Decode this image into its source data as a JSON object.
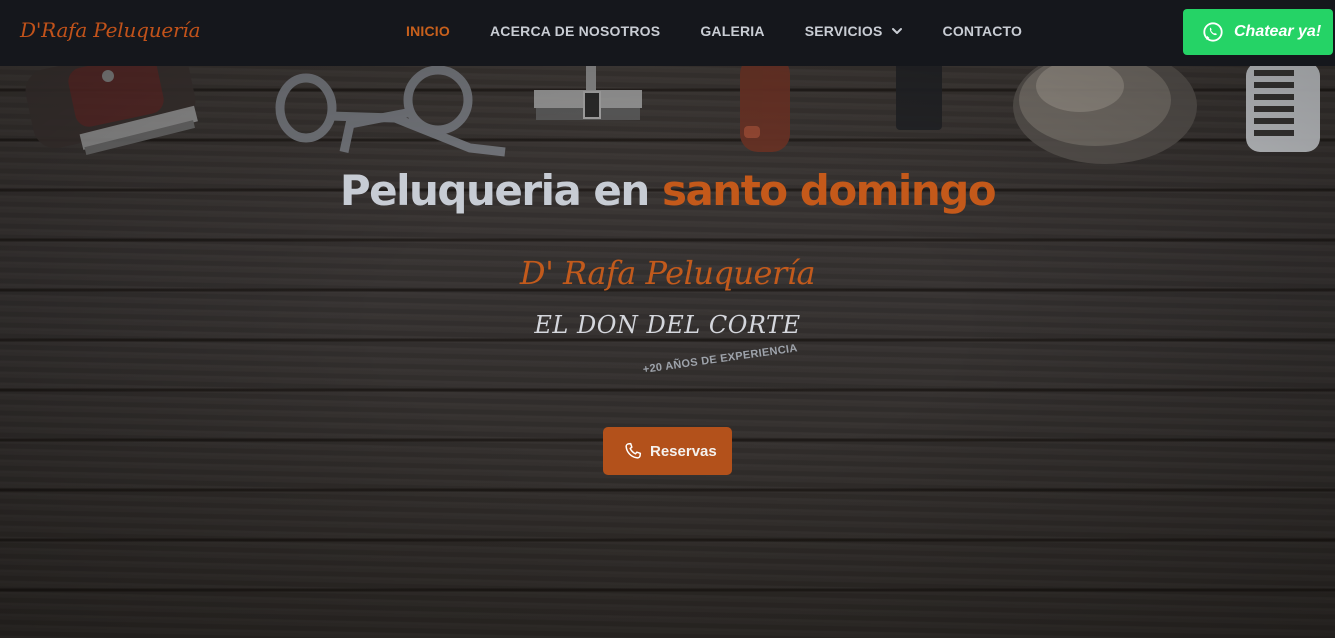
{
  "brand": {
    "name": "D'Rafa Peluquería"
  },
  "nav": {
    "items": [
      {
        "label": "INICIO",
        "active": true
      },
      {
        "label": "ACERCA DE NOSOTROS",
        "active": false
      },
      {
        "label": "GALERIA",
        "active": false
      },
      {
        "label": "SERVICIOS",
        "active": false,
        "has_dropdown": true
      },
      {
        "label": "CONTACTO",
        "active": false
      }
    ]
  },
  "chat": {
    "label": "Chatear ya!",
    "icon": "whatsapp-icon",
    "color": "#25d366"
  },
  "hero": {
    "title_plain": "Peluqueria en ",
    "title_accent": "santo domingo",
    "subtitle": "D' Rafa Peluquería",
    "tagline": "EL DON DEL CORTE",
    "experience": "+20 AÑOS DE EXPERIENCIA",
    "button_label": "Reservas",
    "button_icon": "phone-icon"
  },
  "colors": {
    "accent": "#c4591a",
    "navbar_bg": "#15171c",
    "button_bg": "#b3511b",
    "nav_text": "#c9cdd4"
  }
}
